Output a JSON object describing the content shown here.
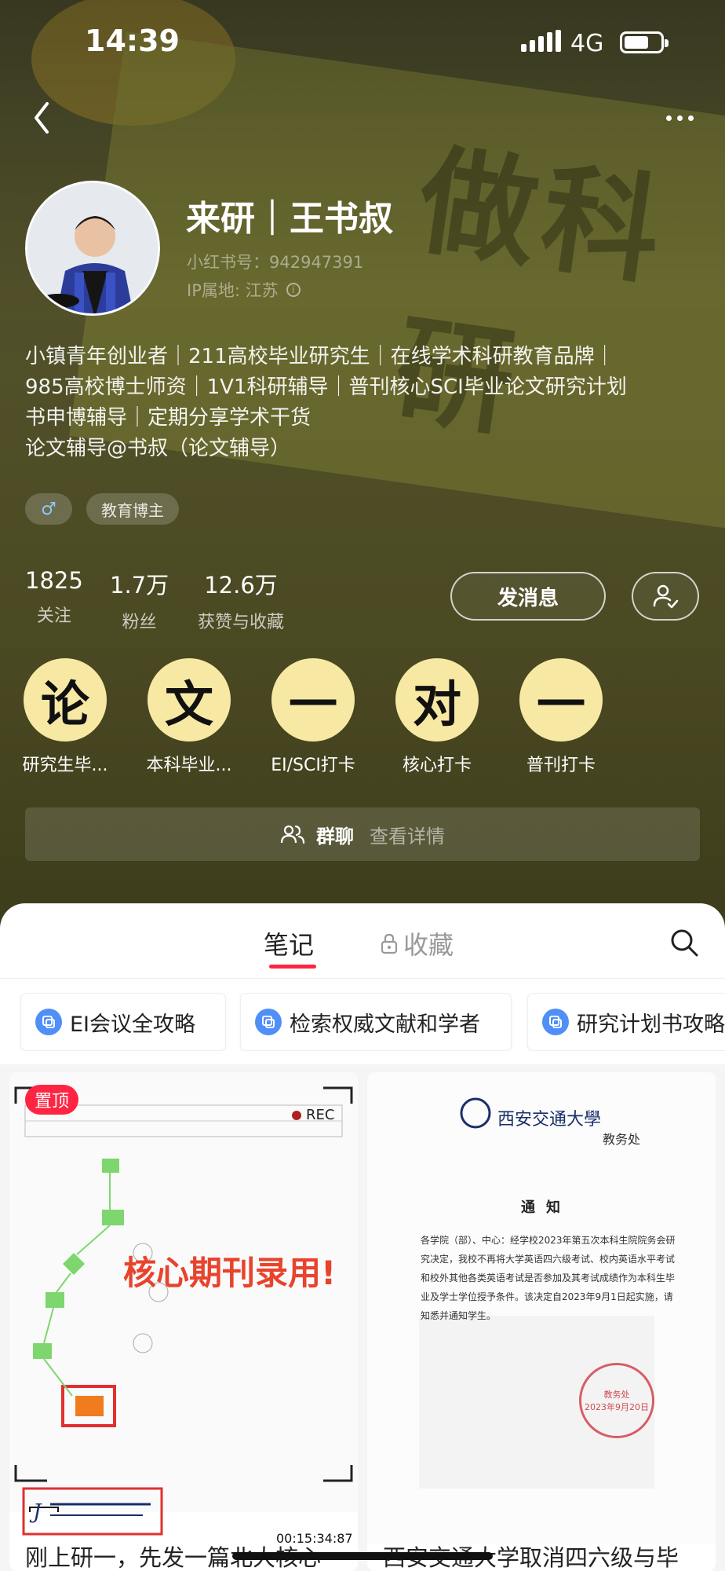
{
  "status": {
    "time": "14:39",
    "network": "4G"
  },
  "profile": {
    "nickname": "来研｜王书叔",
    "red_id": "小红书号：942947391",
    "ip": "IP属地: 江苏",
    "bio_lines": [
      "小镇青年创业者｜211高校毕业研究生｜在线学术科研教育品牌｜",
      "985高校博士师资｜1V1科研辅导｜普刊核心SCI毕业论文研究计划",
      "书申博辅导｜定期分享学术干货",
      "论文辅导@书叔（论文辅导）"
    ],
    "tags": {
      "gender": "♂",
      "category": "教育博主"
    },
    "stats": [
      {
        "num": "1825",
        "label": "关注"
      },
      {
        "num": "1.7万",
        "label": "粉丝"
      },
      {
        "num": "12.6万",
        "label": "获赞与收藏"
      }
    ],
    "message_button": "发消息"
  },
  "collections": [
    {
      "glyph": "论",
      "name": "研究生毕..."
    },
    {
      "glyph": "文",
      "name": "本科毕业..."
    },
    {
      "glyph": "一",
      "name": "EI/SCI打卡"
    },
    {
      "glyph": "对",
      "name": "核心打卡"
    },
    {
      "glyph": "一",
      "name": "普刊打卡"
    }
  ],
  "group_chat": {
    "label": "群聊",
    "detail": "查看详情"
  },
  "tabs": {
    "notes": "笔记",
    "favorites": "收藏"
  },
  "chips": [
    "EI会议全攻略",
    "检索权威文献和学者",
    "研究计划书攻略"
  ],
  "notes": [
    {
      "badge": "置顶",
      "overlay_text": "核心期刊录用!",
      "rec": "REC",
      "timecode": "00:15:34:87",
      "caption": "刚上研一，先发一篇北大核心"
    },
    {
      "doc_title": "西安交通大學",
      "doc_dept": "教务处",
      "doc_notice": "通知",
      "doc_body": "各学院（部）、中心：经学校2023年第五次本科生院院务会研究决定，我校不再将大学英语四六级考试、校内英语水平考试和校外其他各类英语考试是否参加及其考试成绩作为本科生毕业及学士学位授予条件。该决定自2023年9月1日起实施，请知悉并通知学生。",
      "doc_stamp": "2023年9月20日",
      "caption": "西安交通大学取消四六级与毕"
    }
  ]
}
